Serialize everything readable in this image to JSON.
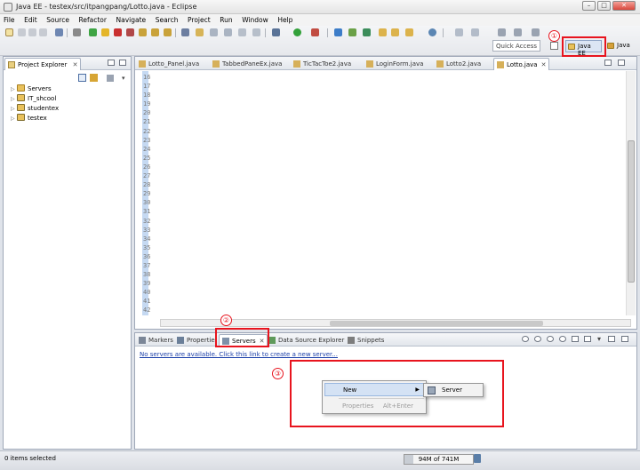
{
  "window": {
    "title": "Java EE - testex/src/itpangpang/Lotto.java - Eclipse",
    "minimize": "–",
    "maximize": "□",
    "close": "✕"
  },
  "menu": [
    "File",
    "Edit",
    "Source",
    "Refactor",
    "Navigate",
    "Search",
    "Project",
    "Run",
    "Window",
    "Help"
  ],
  "toolbar": {
    "quick_access_placeholder": "Quick Access",
    "perspective_active": "Java EE",
    "perspective_other": "Java"
  },
  "explorer": {
    "tab_label": "Project Explorer",
    "projects": [
      {
        "name": "Servers",
        "icon": "folder-icon"
      },
      {
        "name": "IT_shcool",
        "icon": "java-project-icon"
      },
      {
        "name": "studentex",
        "icon": "java-project-icon"
      },
      {
        "name": "testex",
        "icon": "java-project-icon"
      }
    ]
  },
  "editor": {
    "tabs": [
      {
        "label": "Lotto_Panel.java",
        "active": false
      },
      {
        "label": "TabbedPaneEx.java",
        "active": false
      },
      {
        "label": "TicTacToe2.java",
        "active": false
      },
      {
        "label": "LoginForm.java",
        "active": false
      },
      {
        "label": "Lotto2.java",
        "active": false
      },
      {
        "label": "Lotto.java",
        "active": true
      }
    ],
    "line_numbers": [
      "16",
      "17",
      "18",
      "19",
      "20",
      "21",
      "22",
      "23",
      "24",
      "25",
      "26",
      "27",
      "28",
      "29",
      "30",
      "31",
      "32",
      "33",
      "34",
      "35",
      "36",
      "37",
      "38",
      "39",
      "40",
      "41",
      "42"
    ]
  },
  "bottom": {
    "tabs": [
      {
        "label": "Markers",
        "active": false
      },
      {
        "label": "Properties",
        "active": false
      },
      {
        "label": "Servers",
        "active": true
      },
      {
        "label": "Data Source Explorer",
        "active": false
      },
      {
        "label": "Snippets",
        "active": false
      }
    ],
    "empty_message": "No servers are available. Click this link to create a new server..."
  },
  "context_menu": {
    "new_label": "New",
    "properties_label": "Properties",
    "properties_shortcut": "Alt+Enter",
    "submenu_server": "Server"
  },
  "annotations": [
    "①",
    "②",
    "③"
  ],
  "status": {
    "selection": "0 items selected",
    "heap": "94M of 741M",
    "heap_used_fraction": 0.127
  }
}
